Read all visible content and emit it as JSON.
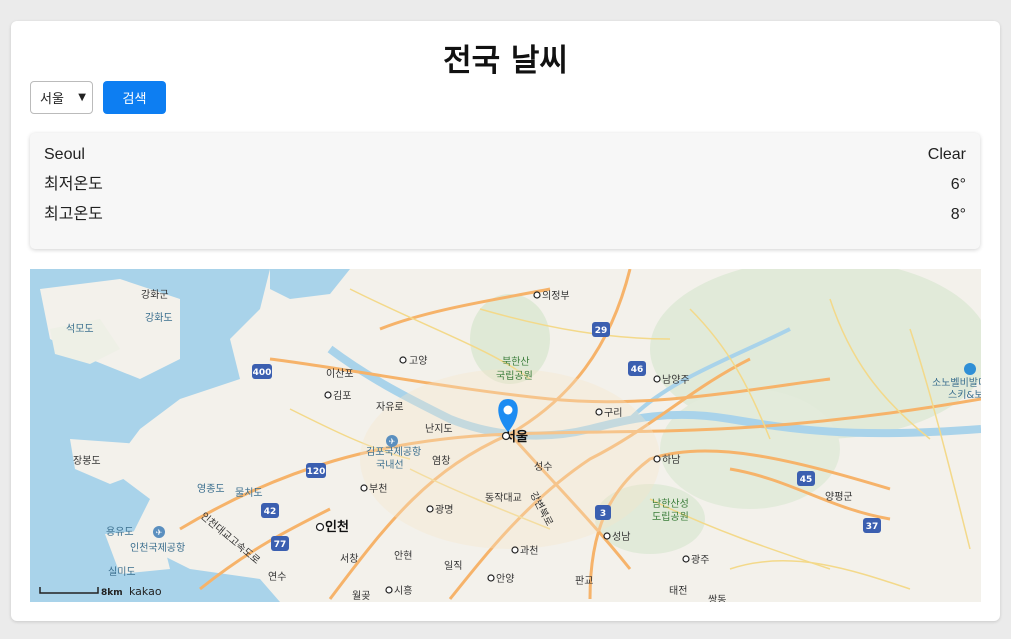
{
  "header": {
    "title": "전국 날씨"
  },
  "controls": {
    "selected_city": "서울",
    "search_label": "검색"
  },
  "weather": {
    "city": "Seoul",
    "condition": "Clear",
    "min_label": "최저온도",
    "min_value": "6°",
    "max_label": "최고온도",
    "max_value": "8°"
  },
  "map": {
    "labels": {
      "ganghwagun": "강화군",
      "ganghwado": "강화도",
      "seokmodo": "석모도",
      "uijeongbu": "의정부",
      "goyang": "고양",
      "bukhansan": "북한산",
      "national_park": "국립공원",
      "namyangju": "남양주",
      "isanpo": "이산포",
      "gimpo": "김포",
      "jayuro": "자유로",
      "nanjido": "난지도",
      "seoul": "서울",
      "guri": "구리",
      "gimpo_airport": "김포국제공항",
      "domestic_terminal": "국내선",
      "yeomchang": "염창",
      "seongsu": "성수",
      "hanam": "하남",
      "jangbongdo": "장봉도",
      "yeongjongdo": "영종도",
      "mulchido": "물치도",
      "bucheon": "부천",
      "dongjakdaegyo": "동작대교",
      "namhansanseong": "남한산성",
      "provincial_park": "도립공원",
      "yangpyeong": "양평군",
      "yongyudo": "용유도",
      "incheon": "인천",
      "gwangmyeong": "광명",
      "seongnam": "성남",
      "incheon_airport": "인천국제공항",
      "gwacheon": "과천",
      "gwangju": "광주",
      "silmido": "실미도",
      "seochang": "서창",
      "anhyeon": "안현",
      "ilji": "일직",
      "anyang": "안양",
      "pangyo": "판교",
      "taejeon": "태전",
      "yeonsu": "연수",
      "siheung": "시흥",
      "wolgot": "월곶",
      "ssangdong": "쌍동",
      "sonobel": "소노벨비발디",
      "ski": "스키&보",
      "bridge_label": "인천대교고속도로",
      "inner_ring": "강변북로"
    },
    "scale_text": "8km",
    "provider": "kakao",
    "route_numbers": [
      "400",
      "29",
      "46",
      "120",
      "45",
      "42",
      "77",
      "3",
      "37"
    ]
  }
}
